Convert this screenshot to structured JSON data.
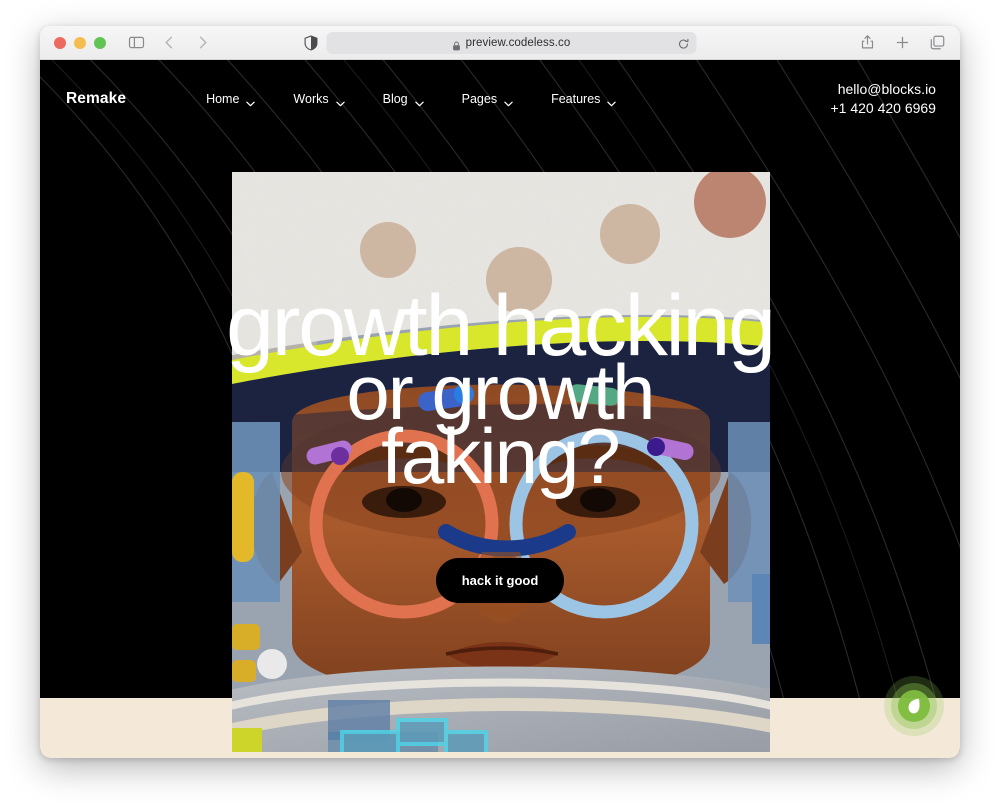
{
  "browser": {
    "traffic_lights": [
      "close",
      "minimize",
      "maximize"
    ],
    "sidebar_icon": "sidebar-icon",
    "back_icon": "chevron-left-icon",
    "forward_icon": "chevron-right-icon",
    "privacy_icon": "privacy-shield-icon",
    "lock_icon": "lock-icon",
    "url": "preview.codeless.co",
    "reload_icon": "reload-icon",
    "share_icon": "share-icon",
    "new_tab_icon": "plus-icon",
    "tabs_icon": "tab-overview-icon"
  },
  "site": {
    "logo": "Remake",
    "nav": [
      {
        "label": "Home",
        "caret": "chevron-down-icon"
      },
      {
        "label": "Works",
        "caret": "chevron-down-icon"
      },
      {
        "label": "Blog",
        "caret": "chevron-down-icon"
      },
      {
        "label": "Pages",
        "caret": "chevron-down-icon"
      },
      {
        "label": "Features",
        "caret": "chevron-down-icon"
      }
    ],
    "contact": {
      "email": "hello@blocks.io",
      "phone": "+1 420 420 6969"
    },
    "hero": {
      "headline_line1": "growth hacking",
      "headline_line2": "or growth",
      "headline_line3": "faking?",
      "cta_label": "hack it good",
      "image_alt": "portrait-with-colorful-glasses"
    },
    "eco_widget": {
      "icon": "leaf-icon"
    },
    "colors": {
      "hero_background": "#000000",
      "footer_background": "#f4e9d8",
      "headline_text": "#ffffff",
      "cta_background": "#000000",
      "cta_text": "#ffffff",
      "eco_green": "#7ebd3e",
      "cap_stripe_yellow": "#d6e629",
      "cap_navy": "#1b2340",
      "glasses_orange": "#e0724f",
      "glasses_blue": "#9cc4e4",
      "accent_purple": "#a563c8",
      "skin": "#a4542a"
    }
  }
}
